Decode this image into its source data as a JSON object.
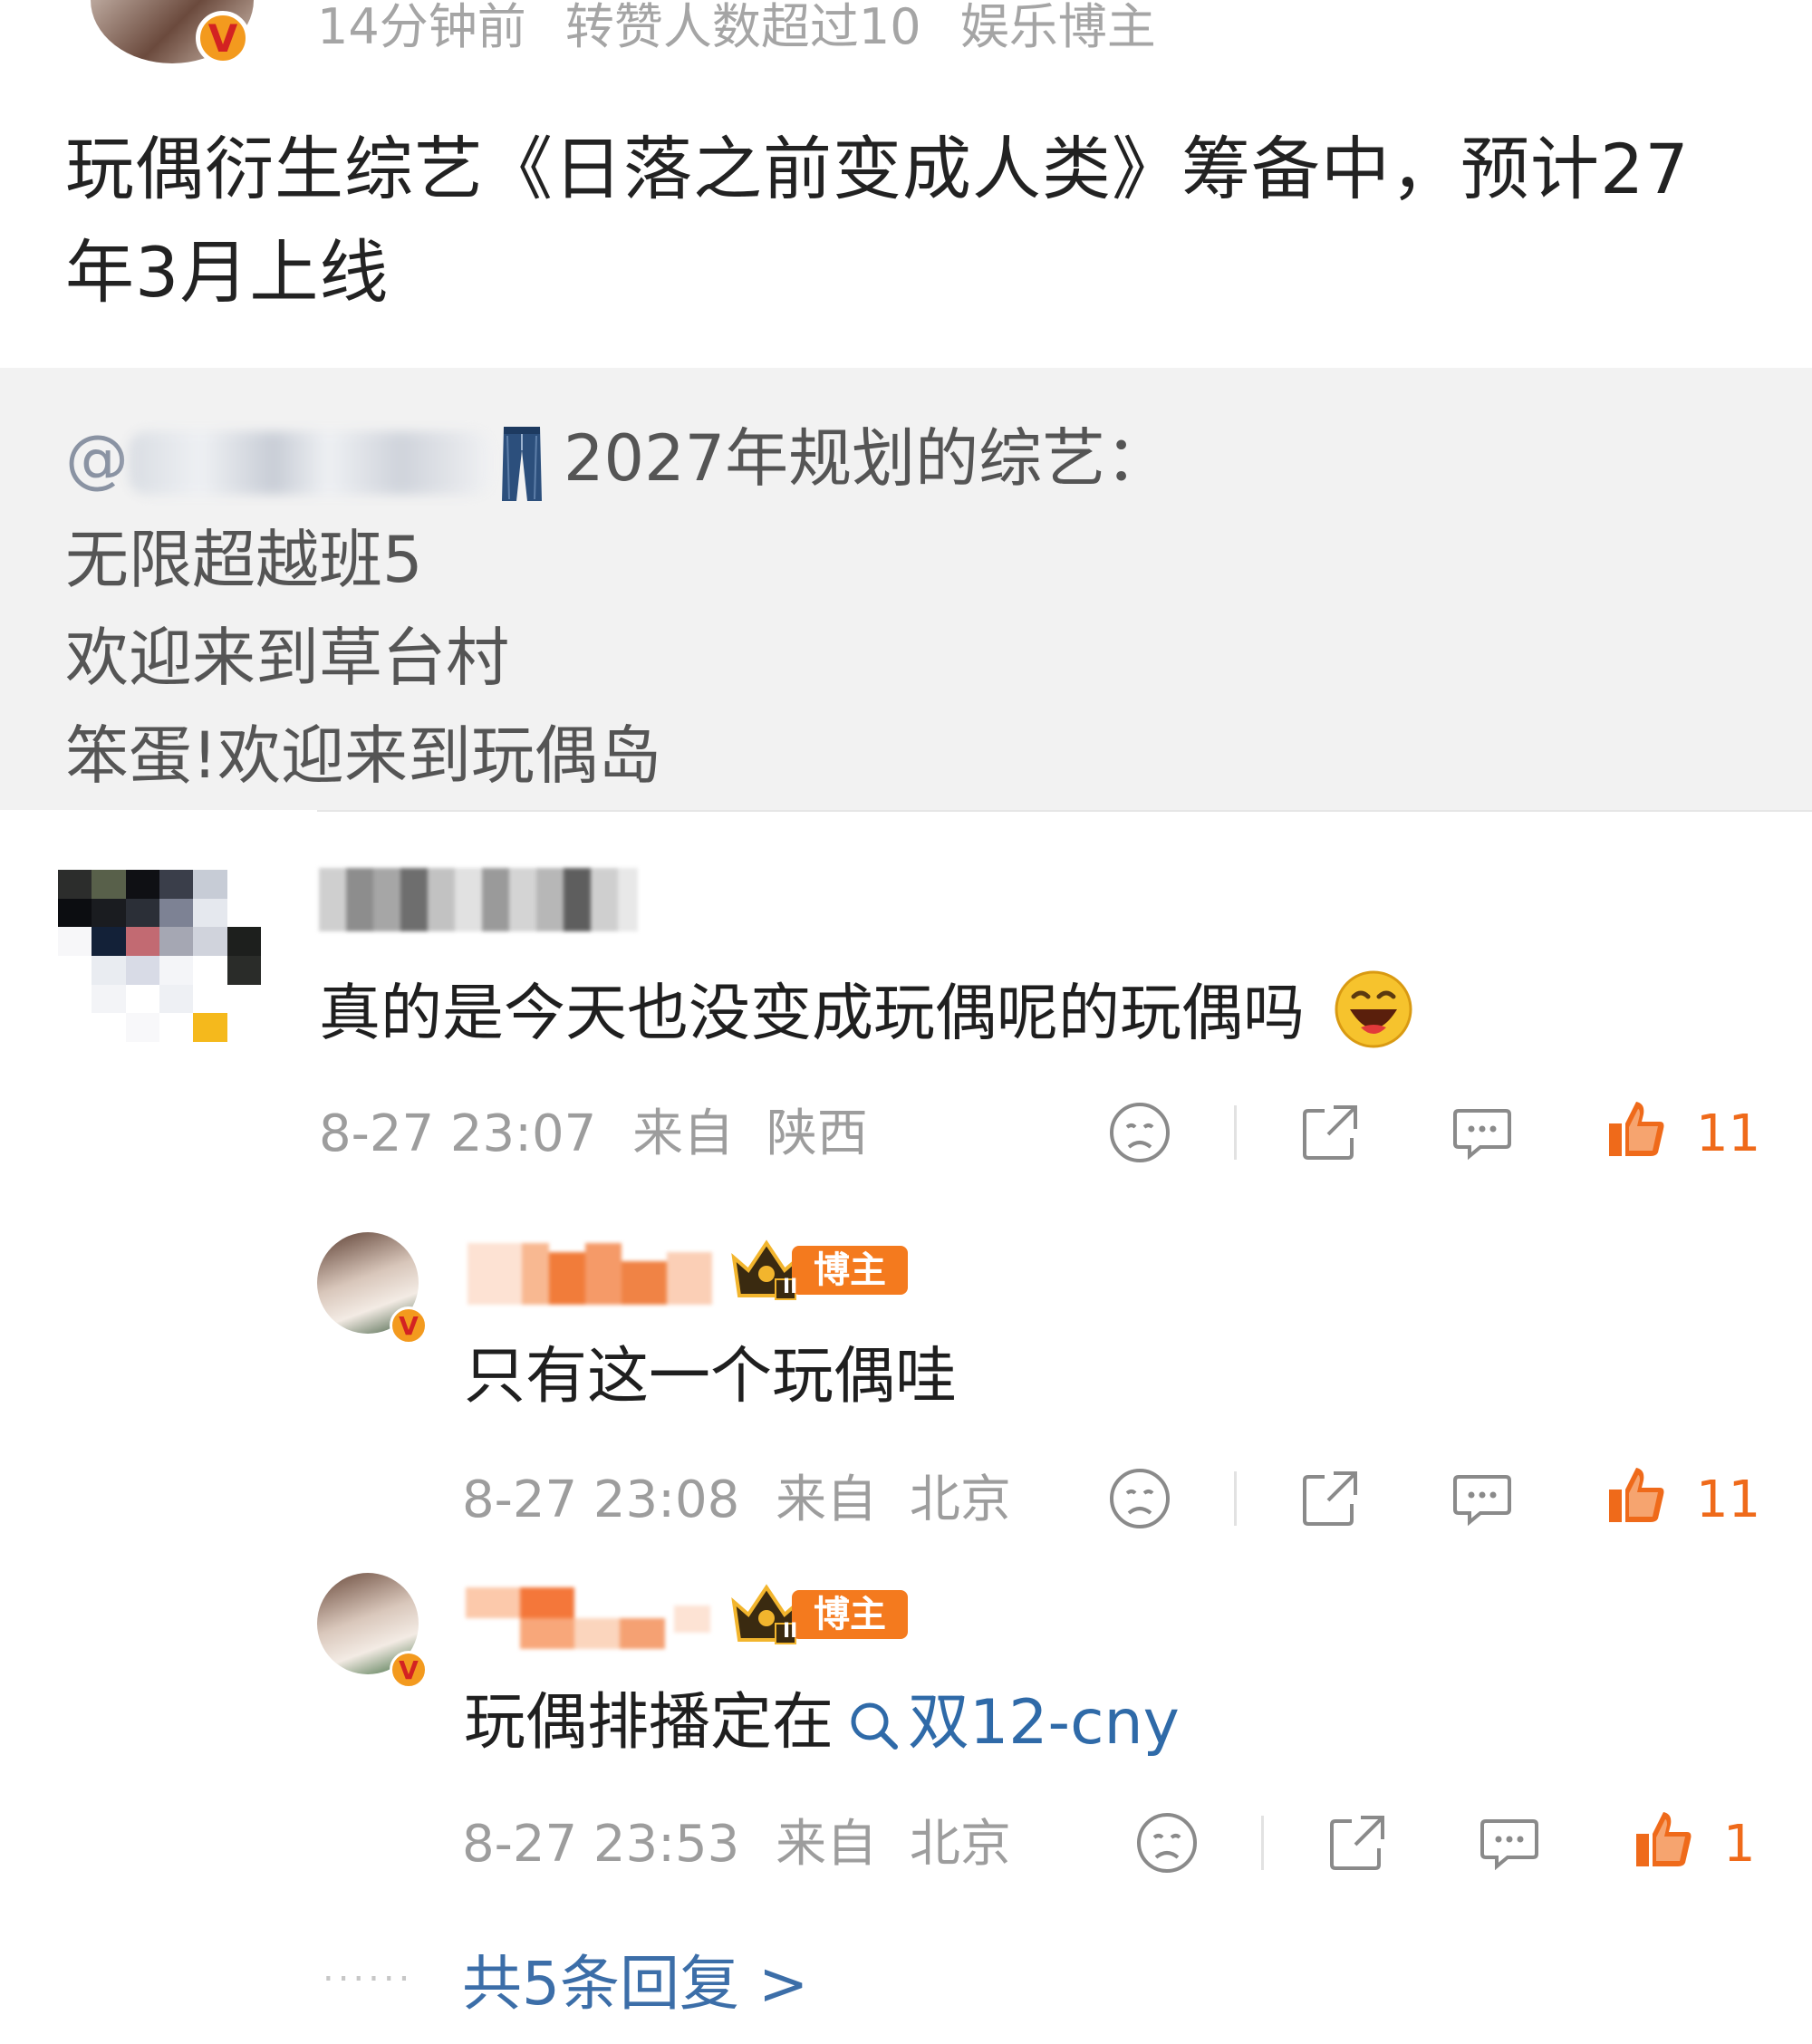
{
  "post": {
    "meta_time": "14分钟前",
    "meta_reposts": "转赞人数超过10",
    "meta_role": "娱乐博主",
    "text": "玩偶衍生综艺《日落之前变成人类》筹备中，预计27年3月上线",
    "verified_badge": "V"
  },
  "quote": {
    "mention_prefix": "@",
    "headline": "2027年规划的综艺：",
    "lines": [
      "无限超越班5",
      "欢迎来到草台村",
      "笨蛋!欢迎来到玩偶岛"
    ]
  },
  "comments": [
    {
      "text": "真的是今天也没变成玩偶呢的玩偶吗",
      "time": "8-27 23:07",
      "location_label": "来自",
      "location": "陕西",
      "likes": "11"
    }
  ],
  "replies": [
    {
      "tag": "博主",
      "tag_level": "II",
      "text": "只有这一个玩偶哇",
      "time": "8-27 23:08",
      "location_label": "来自",
      "location": "北京",
      "likes": "11"
    },
    {
      "tag": "博主",
      "tag_level": "II",
      "text_prefix": "玩偶排播定在",
      "link_text": "双12-cny",
      "time": "8-27 23:53",
      "location_label": "来自",
      "location": "北京",
      "likes": "1"
    }
  ],
  "more_replies": "共5条回复 >",
  "more_dots": "......",
  "colors": {
    "like": "#ef6a1a",
    "link": "#3c6ea8",
    "blogger_tag": "#f47a1e",
    "quote_bg": "#f2f2f2"
  },
  "icons": [
    "verified-v-icon",
    "jeans-icon",
    "laughing-emoji-icon",
    "sad-face-icon",
    "share-icon",
    "comment-icon",
    "thumbs-up-icon",
    "crown-icon",
    "search-icon"
  ]
}
